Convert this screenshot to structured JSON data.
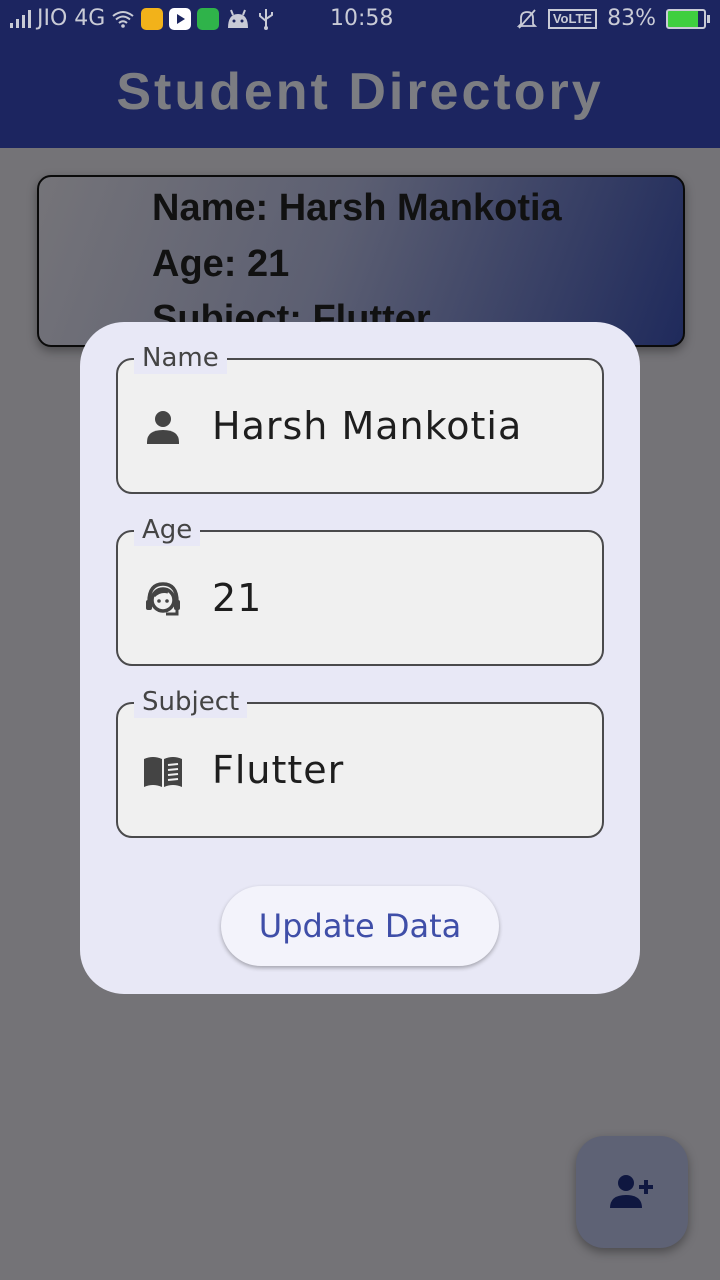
{
  "status_bar": {
    "carrier": "JIO 4G",
    "time": "10:58",
    "network_badge": "VoLTE",
    "battery": "83%",
    "battery_level": 0.83
  },
  "app_bar": {
    "title": "Student Directory"
  },
  "student_card": {
    "name_line": "Name: Harsh Mankotia",
    "age_line": "Age: 21",
    "subject_line": "Subject: Flutter"
  },
  "dialog": {
    "fields": [
      {
        "label": "Name",
        "value": "Harsh Mankotia",
        "icon": "person-icon"
      },
      {
        "label": "Age",
        "value": "21",
        "icon": "face-headset-icon"
      },
      {
        "label": "Subject",
        "value": "Flutter",
        "icon": "book-icon"
      }
    ],
    "update_button": "Update Data"
  },
  "fab": {
    "icon": "add-person-icon"
  },
  "colors": {
    "app_bar": "#1c2560",
    "scrim": "#747377",
    "dialog": "#e8e8f6",
    "accent": "#3f4ea8"
  }
}
